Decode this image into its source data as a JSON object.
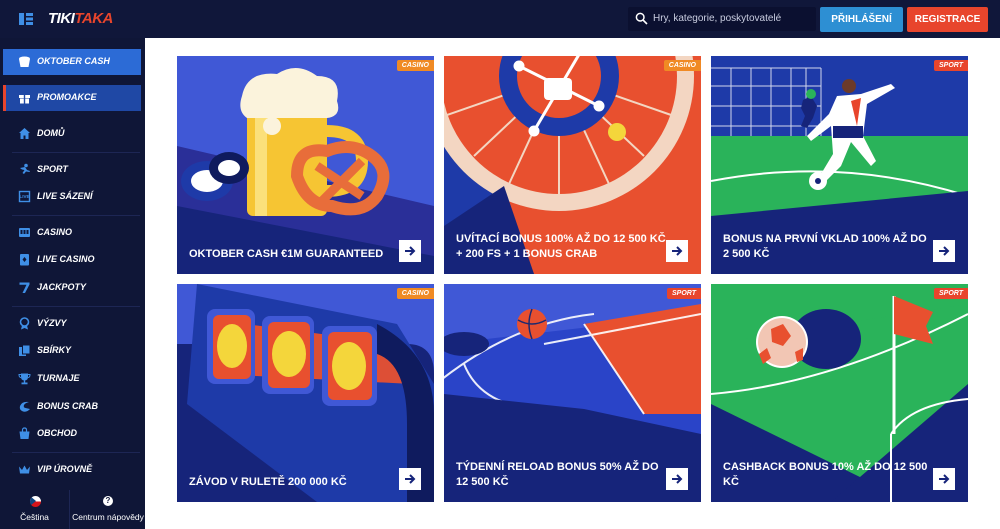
{
  "header": {
    "logo_part1": "TIKI",
    "logo_part2": "TAKA",
    "search_placeholder": "Hry, kategorie, poskytovatelé",
    "login_label": "PŘIHLÁŠENÍ",
    "register_label": "REGISTRACE"
  },
  "sidebar": {
    "items": [
      {
        "label": "OKTOBER CASH",
        "icon": "bucket-icon"
      },
      {
        "label": "PROMOAKCE",
        "icon": "gift-icon"
      },
      {
        "label": "DOMŮ",
        "icon": "home-icon"
      },
      {
        "label": "SPORT",
        "icon": "sport-icon"
      },
      {
        "label": "LIVE SÁZENÍ",
        "icon": "live-betting-icon"
      },
      {
        "label": "CASINO",
        "icon": "casino-icon"
      },
      {
        "label": "LIVE CASINO",
        "icon": "live-casino-icon"
      },
      {
        "label": "JACKPOTY",
        "icon": "jackpot-icon"
      },
      {
        "label": "VÝZVY",
        "icon": "challenges-icon"
      },
      {
        "label": "SBÍRKY",
        "icon": "collections-icon"
      },
      {
        "label": "TURNAJE",
        "icon": "trophy-icon"
      },
      {
        "label": "BONUS CRAB",
        "icon": "crab-icon"
      },
      {
        "label": "OBCHOD",
        "icon": "shop-icon"
      },
      {
        "label": "VIP ÚROVNĚ",
        "icon": "crown-icon"
      }
    ],
    "language_label": "Čeština",
    "help_label": "Centrum nápovědy"
  },
  "promos": [
    {
      "title": "OKTOBER CASH €1M GUARANTEED",
      "badge": "CASINO"
    },
    {
      "title": "UVÍTACÍ BONUS 100% AŽ DO 12 500 KČ + 200 FS + 1 BONUS CRAB",
      "badge": "CASINO"
    },
    {
      "title": "BONUS NA PRVNÍ VKLAD 100% AŽ DO 2 500 KČ",
      "badge": "SPORT"
    },
    {
      "title": "ZÁVOD V RULETĚ 200 000 KČ",
      "badge": "CASINO"
    },
    {
      "title": "TÝDENNÍ RELOAD BONUS 50% AŽ DO 12 500 KČ",
      "badge": "SPORT"
    },
    {
      "title": "CASHBACK BONUS 10% AŽ DO 12 500 KČ",
      "badge": "SPORT"
    }
  ],
  "colors": {
    "header_bg": "#10173a",
    "sidebar_bg": "#0f1637",
    "accent_blue": "#2d8fd3",
    "accent_red": "#e8452c",
    "casino_badge": "#f08a24",
    "card_navy": "#16247a"
  }
}
